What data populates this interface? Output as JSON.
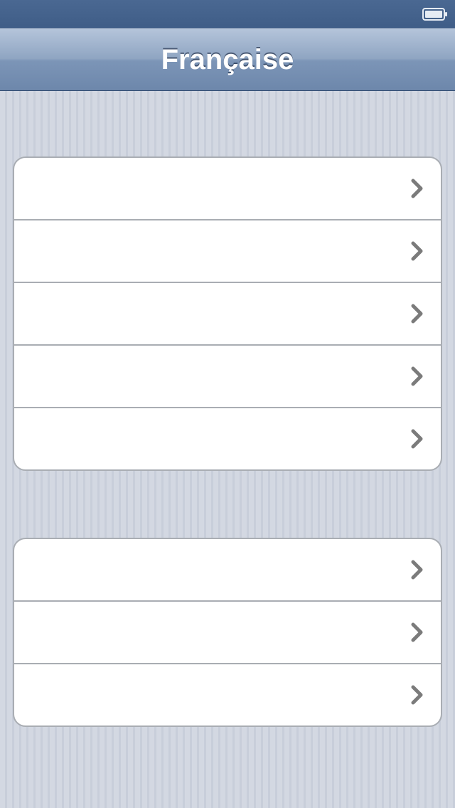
{
  "nav_bar": {
    "title": "Française"
  },
  "status_bar": {
    "battery_icon": "battery-icon"
  },
  "groups": [
    {
      "rows": [
        {
          "icon": "chevron-right-icon"
        },
        {
          "icon": "chevron-right-icon"
        },
        {
          "icon": "chevron-right-icon"
        },
        {
          "icon": "chevron-right-icon"
        },
        {
          "icon": "chevron-right-icon"
        }
      ]
    },
    {
      "rows": [
        {
          "icon": "chevron-right-icon"
        },
        {
          "icon": "chevron-right-icon"
        },
        {
          "icon": "chevron-right-icon"
        }
      ]
    }
  ],
  "colors": {
    "nav_gradient_top": "#b4c4da",
    "nav_gradient_bottom": "#6d87ab",
    "status_bar": "#3f5d87",
    "chevron": "#7b7b7b",
    "cell_background": "#ffffff",
    "separator": "#a9adb3"
  }
}
